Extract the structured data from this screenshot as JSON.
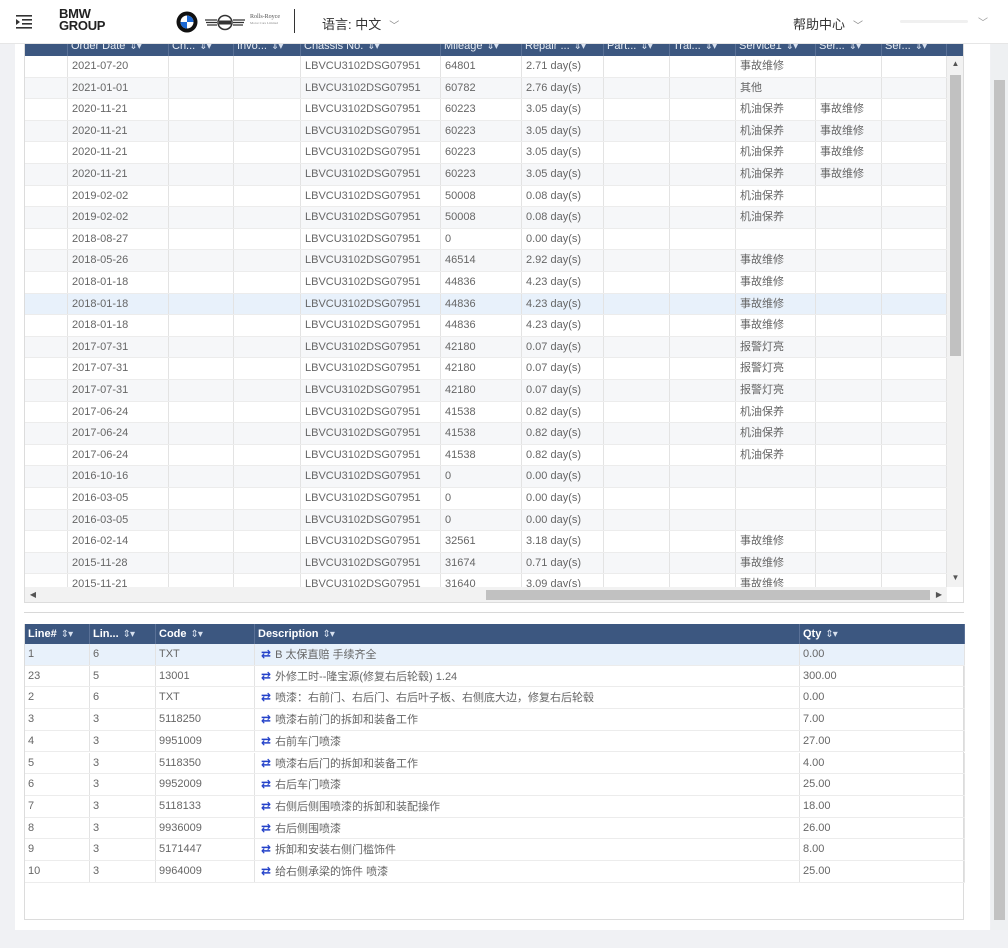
{
  "header": {
    "brand_line1": "BMW",
    "brand_line2": "GROUP",
    "logos": [
      "bmw-logo",
      "mini-logo",
      "rolls-royce-logo"
    ],
    "rolls_royce_text": "Rolls-Royce",
    "rolls_royce_sub": "Motor Cars Limited",
    "language_label": "语言: 中文",
    "help_label": "帮助中心",
    "user_menu_label": ""
  },
  "orders_grid": {
    "headers": [
      "",
      "Order Date",
      "Ch...",
      "Invo...",
      "Chassis No.",
      "Mileage",
      "Repair ...",
      "Part...",
      "Trai...",
      "Service1",
      "Ser...",
      "Ser..."
    ],
    "rows": [
      [
        "",
        "2021-07-20",
        "",
        "",
        "LBVCU3102DSG07951",
        "64801",
        "2.71 day(s)",
        "",
        "",
        "事故维修",
        "",
        ""
      ],
      [
        "",
        "2021-01-01",
        "",
        "",
        "LBVCU3102DSG07951",
        "60782",
        "2.76 day(s)",
        "",
        "",
        "其他",
        "",
        ""
      ],
      [
        "",
        "2020-11-21",
        "",
        "",
        "LBVCU3102DSG07951",
        "60223",
        "3.05 day(s)",
        "",
        "",
        "机油保养",
        "事故维修",
        ""
      ],
      [
        "",
        "2020-11-21",
        "",
        "",
        "LBVCU3102DSG07951",
        "60223",
        "3.05 day(s)",
        "",
        "",
        "机油保养",
        "事故维修",
        ""
      ],
      [
        "",
        "2020-11-21",
        "",
        "",
        "LBVCU3102DSG07951",
        "60223",
        "3.05 day(s)",
        "",
        "",
        "机油保养",
        "事故维修",
        ""
      ],
      [
        "",
        "2020-11-21",
        "",
        "",
        "LBVCU3102DSG07951",
        "60223",
        "3.05 day(s)",
        "",
        "",
        "机油保养",
        "事故维修",
        ""
      ],
      [
        "",
        "2019-02-02",
        "",
        "",
        "LBVCU3102DSG07951",
        "50008",
        "0.08 day(s)",
        "",
        "",
        "机油保养",
        "",
        ""
      ],
      [
        "",
        "2019-02-02",
        "",
        "",
        "LBVCU3102DSG07951",
        "50008",
        "0.08 day(s)",
        "",
        "",
        "机油保养",
        "",
        ""
      ],
      [
        "",
        "2018-08-27",
        "",
        "",
        "LBVCU3102DSG07951",
        "0",
        "0.00 day(s)",
        "",
        "",
        "",
        "",
        ""
      ],
      [
        "",
        "2018-05-26",
        "",
        "",
        "LBVCU3102DSG07951",
        "46514",
        "2.92 day(s)",
        "",
        "",
        "事故维修",
        "",
        ""
      ],
      [
        "",
        "2018-01-18",
        "",
        "",
        "LBVCU3102DSG07951",
        "44836",
        "4.23 day(s)",
        "",
        "",
        "事故维修",
        "",
        ""
      ],
      [
        "",
        "2018-01-18",
        "",
        "",
        "LBVCU3102DSG07951",
        "44836",
        "4.23 day(s)",
        "",
        "",
        "事故维修",
        "",
        ""
      ],
      [
        "",
        "2018-01-18",
        "",
        "",
        "LBVCU3102DSG07951",
        "44836",
        "4.23 day(s)",
        "",
        "",
        "事故维修",
        "",
        ""
      ],
      [
        "",
        "2017-07-31",
        "",
        "",
        "LBVCU3102DSG07951",
        "42180",
        "0.07 day(s)",
        "",
        "",
        "报警灯亮",
        "",
        ""
      ],
      [
        "",
        "2017-07-31",
        "",
        "",
        "LBVCU3102DSG07951",
        "42180",
        "0.07 day(s)",
        "",
        "",
        "报警灯亮",
        "",
        ""
      ],
      [
        "",
        "2017-07-31",
        "",
        "",
        "LBVCU3102DSG07951",
        "42180",
        "0.07 day(s)",
        "",
        "",
        "报警灯亮",
        "",
        ""
      ],
      [
        "",
        "2017-06-24",
        "",
        "",
        "LBVCU3102DSG07951",
        "41538",
        "0.82 day(s)",
        "",
        "",
        "机油保养",
        "",
        ""
      ],
      [
        "",
        "2017-06-24",
        "",
        "",
        "LBVCU3102DSG07951",
        "41538",
        "0.82 day(s)",
        "",
        "",
        "机油保养",
        "",
        ""
      ],
      [
        "",
        "2017-06-24",
        "",
        "",
        "LBVCU3102DSG07951",
        "41538",
        "0.82 day(s)",
        "",
        "",
        "机油保养",
        "",
        ""
      ],
      [
        "",
        "2016-10-16",
        "",
        "",
        "LBVCU3102DSG07951",
        "0",
        "0.00 day(s)",
        "",
        "",
        "",
        "",
        ""
      ],
      [
        "",
        "2016-03-05",
        "",
        "",
        "LBVCU3102DSG07951",
        "0",
        "0.00 day(s)",
        "",
        "",
        "",
        "",
        ""
      ],
      [
        "",
        "2016-03-05",
        "",
        "",
        "LBVCU3102DSG07951",
        "0",
        "0.00 day(s)",
        "",
        "",
        "",
        "",
        ""
      ],
      [
        "",
        "2016-02-14",
        "",
        "",
        "LBVCU3102DSG07951",
        "32561",
        "3.18 day(s)",
        "",
        "",
        "事故维修",
        "",
        ""
      ],
      [
        "",
        "2015-11-28",
        "",
        "",
        "LBVCU3102DSG07951",
        "31674",
        "0.71 day(s)",
        "",
        "",
        "事故维修",
        "",
        ""
      ],
      [
        "",
        "2015-11-21",
        "",
        "",
        "LBVCU3102DSG07951",
        "31640",
        "3.09 day(s)",
        "",
        "",
        "事故维修",
        "",
        ""
      ]
    ]
  },
  "lines_grid": {
    "headers": [
      "Line#",
      "Lin...",
      "Code",
      "Description",
      "Qty"
    ],
    "rows": [
      [
        "1",
        "6",
        "TXT",
        "B 太保直赔 手续齐全",
        "0.00"
      ],
      [
        "23",
        "5",
        "13001",
        "外修工时--隆宝源(修复右后轮毂) 1.24",
        "300.00"
      ],
      [
        "2",
        "6",
        "TXT",
        "喷漆：右前门、右后门、右后叶子板、右侧底大边，修复右后轮毂",
        "0.00"
      ],
      [
        "3",
        "3",
        "5118250",
        "喷漆右前门的拆卸和装备工作",
        "7.00"
      ],
      [
        "4",
        "3",
        "9951009",
        "右前车门喷漆",
        "27.00"
      ],
      [
        "5",
        "3",
        "5118350",
        "喷漆右后门的拆卸和装备工作",
        "4.00"
      ],
      [
        "6",
        "3",
        "9952009",
        "右后车门喷漆",
        "25.00"
      ],
      [
        "7",
        "3",
        "5118133",
        "右侧后侧围喷漆的拆卸和装配操作",
        "18.00"
      ],
      [
        "8",
        "3",
        "9936009",
        "右后侧围喷漆",
        "26.00"
      ],
      [
        "9",
        "3",
        "5171447",
        "拆卸和安装右侧门槛饰件",
        "8.00"
      ],
      [
        "10",
        "3",
        "9964009",
        "给右侧承梁的饰件 喷漆",
        "25.00"
      ]
    ]
  },
  "sort_filter_glyph": "⇕▾",
  "transfer_glyph": "⇄",
  "colors": {
    "header_bg": "#3c5780",
    "selected_row": "#e8f1fb",
    "transfer_icon": "#2442c9"
  }
}
